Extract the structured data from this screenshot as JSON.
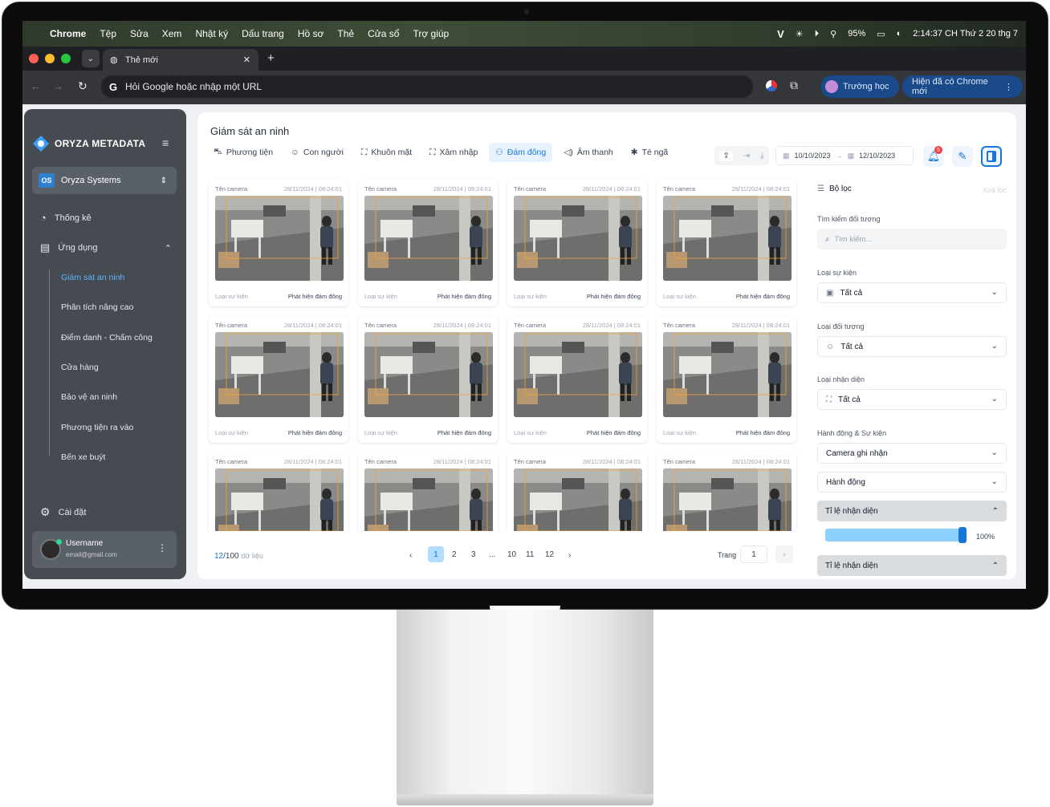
{
  "menubar": {
    "app": "Chrome",
    "items": [
      "Tệp",
      "Sửa",
      "Xem",
      "Nhật ký",
      "Dấu trang",
      "Hồ sơ",
      "Thẻ",
      "Cửa sổ",
      "Trợ giúp"
    ],
    "battery": "95%",
    "clock": "2:14:37 CH Thứ 2 20 thg 7"
  },
  "browser": {
    "tab_title": "Thẻ mới",
    "omnibox": "Hỏi Google hoặc nhập một URL",
    "profile": "Trường học",
    "update": "Hiện đã có Chrome mới"
  },
  "sidebar": {
    "brand": "ORYZA METADATA",
    "org": "Oryza Systems",
    "org_badge": "OS",
    "stats": "Thống kê",
    "apps": "Ứng dụng",
    "sub": [
      "Giám sát an ninh",
      "Phân tích nâng cao",
      "Điểm danh - Chấm công",
      "Cửa hàng",
      "Bảo vệ an ninh",
      "Phương tiện ra vào",
      "Bến xe buýt"
    ],
    "settings": "Cài đặt",
    "username": "Username",
    "email": "email@gmail.com"
  },
  "header": {
    "title": "Giám sát an ninh",
    "date_from": "10/10/2023",
    "date_to": "12/10/2023",
    "notif_count": "5"
  },
  "event_tabs": [
    "Phương tiện",
    "Con người",
    "Khuôn mặt",
    "Xâm nhập",
    "Đám đông",
    "Âm thanh",
    "Té ngã"
  ],
  "card": {
    "camera": "Tên camera",
    "time": "28/11/2024",
    "clock": "08:24:01",
    "event_label": "Loại sự kiện",
    "event_value": "Phát hiện đám đông"
  },
  "pager": {
    "shown": "12",
    "total": "/100",
    "suffix": "dữ liệu",
    "pages": [
      "1",
      "2",
      "3",
      "...",
      "10",
      "11",
      "12"
    ],
    "goto_label": "Trang",
    "goto_value": "1"
  },
  "filters": {
    "title": "Bộ lọc",
    "clear": "Xoá lọc",
    "search_label": "Tìm kiếm đối tượng",
    "search_ph": "Tìm kiếm...",
    "event_type": "Loại sự kiện",
    "obj_type": "Loại đối tượng",
    "recog_type": "Loại nhận diện",
    "all": "Tất cả",
    "actions": "Hành động & Sự kiện",
    "camera": "Camera ghi nhận",
    "action": "Hành động",
    "ratio": "Tỉ lệ nhận diện",
    "ratio_value": "100%"
  }
}
